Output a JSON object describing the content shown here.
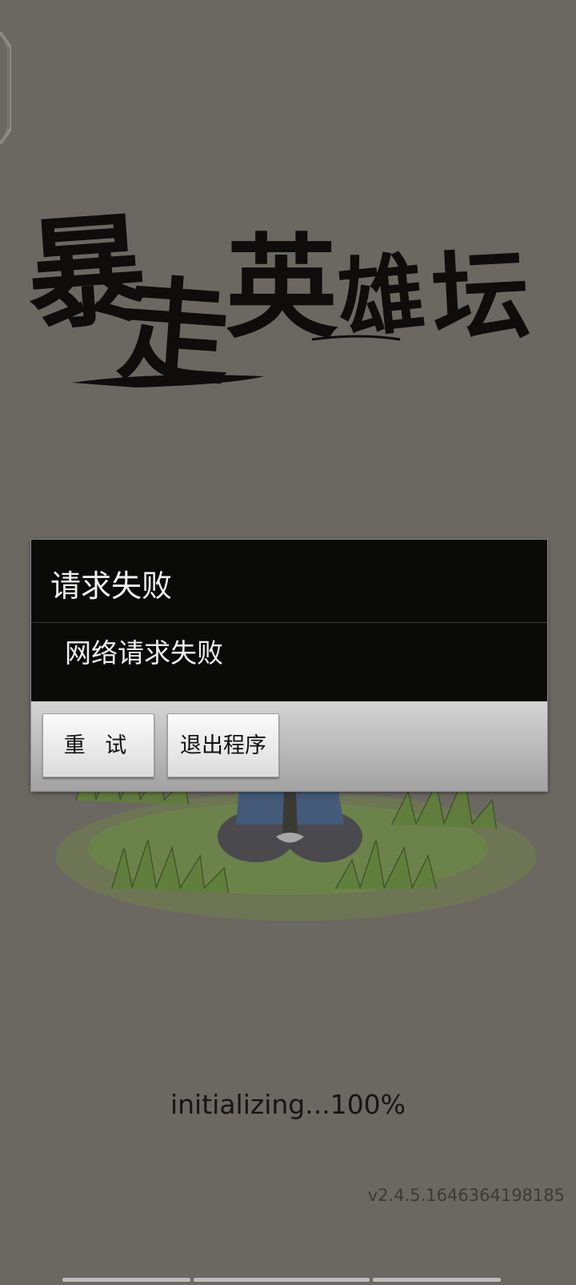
{
  "app": {
    "logo_text": "暴走英雄坛",
    "logo_chars": [
      "暴",
      "走",
      "英",
      "雄",
      "坛"
    ]
  },
  "dialog": {
    "title": "请求失败",
    "message": "网络请求失败",
    "retry_label": "重 试",
    "exit_label": "退出程序"
  },
  "loading": {
    "status": "initializing...100%",
    "progress_percent": 100
  },
  "footer": {
    "version": "v2.4.5.1646364198185"
  },
  "colors": {
    "background": "#6b6862",
    "dialog_background": "#0a0a09",
    "dialog_text": "#f2f2f2",
    "button_bar": "#b8b8b8",
    "grass": "#6c8a45"
  },
  "icons": {
    "corner": "corner-ornament-icon"
  }
}
